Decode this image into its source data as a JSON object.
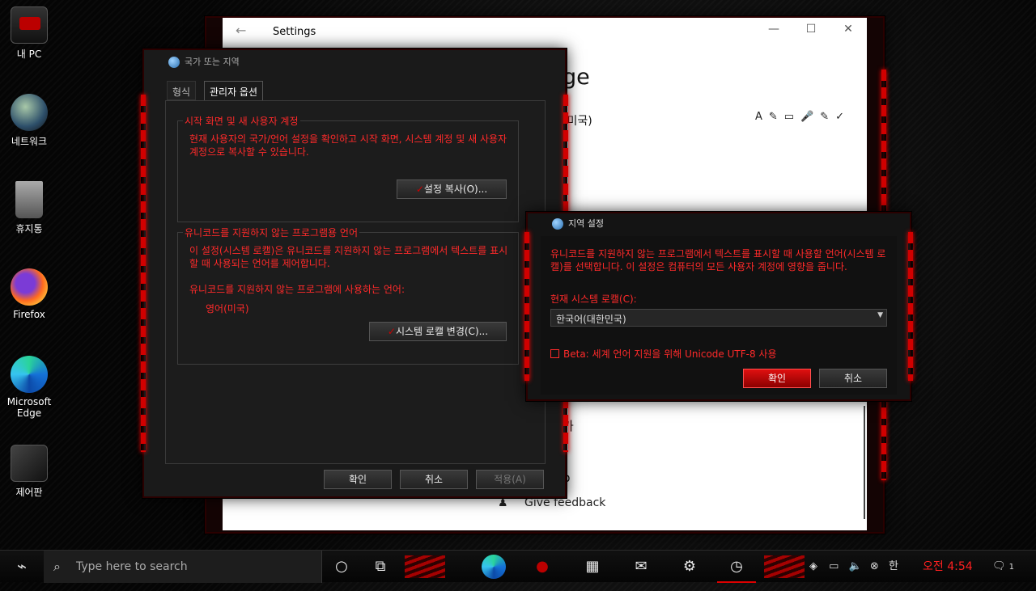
{
  "desktop": {
    "icons": [
      {
        "label": "내 PC",
        "icon": "computer-icon"
      },
      {
        "label": "네트워크",
        "icon": "network-icon"
      },
      {
        "label": "휴지통",
        "icon": "recycle-bin-icon"
      },
      {
        "label": "Firefox",
        "icon": "firefox-icon"
      },
      {
        "label": "Microsoft Edge",
        "icon": "edge-icon"
      },
      {
        "label": "제어판",
        "icon": "control-panel-icon"
      }
    ]
  },
  "settings": {
    "title": "Settings",
    "heading": "ge",
    "language_line": "(미국)",
    "bg_line1": "가",
    "bg_line2": "p",
    "feedback": "Give feedback",
    "lang_feature_icons": "A✎▭🎤✎✓"
  },
  "region_dialog": {
    "title": "국가 또는 지역",
    "tabs": [
      "형식",
      "관리자 옵션"
    ],
    "group1": {
      "title": "시작 화면 및 새 사용자 계정",
      "text": "현재 사용자의 국가/언어 설정을 확인하고 시작 화면, 시스템 계정 및 새 사용자 계정으로 복사할 수 있습니다.",
      "button": "설정 복사(O)..."
    },
    "group2": {
      "title": "유니코드를 지원하지 않는 프로그램용 언어",
      "text": "이 설정(시스템 로캘)은 유니코드를 지원하지 않는 프로그램에서 텍스트를 표시할 때 사용되는 언어를 제어합니다.",
      "current_label": "유니코드를 지원하지 않는 프로그램에 사용하는 언어:",
      "current_value": "영어(미국)",
      "button": "시스템 로캘 변경(C)..."
    },
    "buttons": {
      "ok": "확인",
      "cancel": "취소",
      "apply": "적용(A)"
    }
  },
  "locale_dialog": {
    "title": "지역 설정",
    "description": "유니코드를 지원하지 않는 프로그램에서 텍스트를 표시할 때 사용할 언어(시스템 로캘)를 선택합니다. 이 설정은 컴퓨터의 모든 사용자 계정에 영향을 줍니다.",
    "current_label": "현재 시스템 로캘(C):",
    "current_value": "한국어(대한민국)",
    "beta_label": "Beta: 세계 언어 지원을 위해 Unicode UTF-8 사용",
    "ok": "확인",
    "cancel": "취소"
  },
  "taskbar": {
    "search_placeholder": "Type here to search",
    "clock": "오전 4:54",
    "notification_count": "1"
  },
  "colors": {
    "accent_red": "#ff2a2a",
    "rog_red": "#d10000"
  }
}
